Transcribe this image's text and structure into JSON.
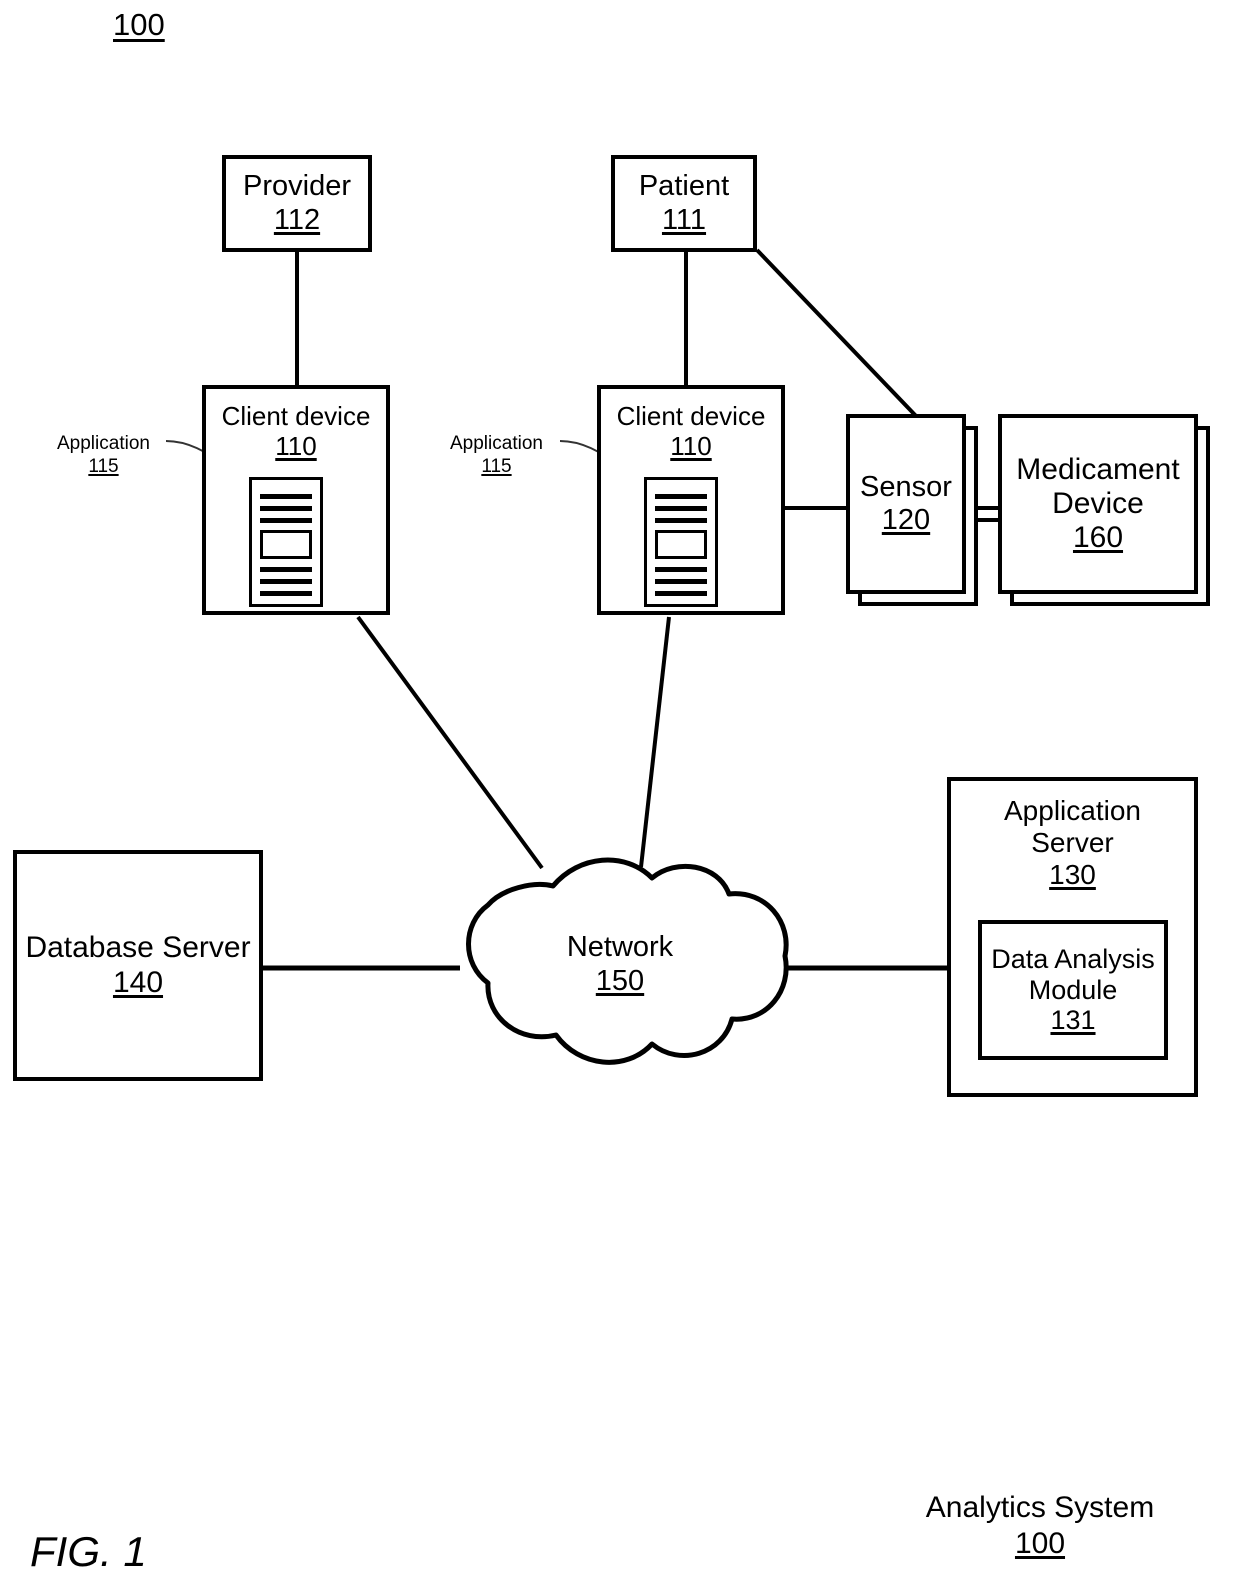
{
  "figure": {
    "top_reference": "100",
    "caption": "FIG. 1",
    "system_label": "Analytics System",
    "system_reference": "100"
  },
  "nodes": {
    "provider": {
      "title": "Provider",
      "ref": "112"
    },
    "patient": {
      "title": "Patient",
      "ref": "111"
    },
    "client_device_provider": {
      "title": "Client device",
      "ref": "110"
    },
    "client_device_patient": {
      "title": "Client device",
      "ref": "110"
    },
    "sensor": {
      "title": "Sensor",
      "ref": "120"
    },
    "medicament": {
      "title": "Medicament\nDevice",
      "ref": "160"
    },
    "network": {
      "title": "Network",
      "ref": "150"
    },
    "database_server": {
      "title": "Database Server",
      "ref": "140"
    },
    "application_server": {
      "title": "Application\nServer",
      "ref": "130"
    },
    "data_analysis_module": {
      "title": "Data Analysis\nModule",
      "ref": "131"
    }
  },
  "callouts": {
    "application_provider": {
      "title": "Application",
      "ref": "115"
    },
    "application_patient": {
      "title": "Application",
      "ref": "115"
    }
  },
  "icons": {
    "document_glyph": "document-icon",
    "cloud_glyph": "cloud-icon"
  },
  "style": {
    "stroke": "#000000",
    "fill": "#ffffff",
    "leader_stroke": "#333333"
  },
  "connections": [
    {
      "from": "provider",
      "to": "client_device_provider",
      "kind": "vertical"
    },
    {
      "from": "patient",
      "to": "client_device_patient",
      "kind": "vertical"
    },
    {
      "from": "patient",
      "to": "sensor",
      "kind": "diagonal"
    },
    {
      "from": "client_device_patient",
      "to": "sensor",
      "kind": "horizontal"
    },
    {
      "from": "sensor",
      "to": "medicament",
      "kind": "horizontal"
    },
    {
      "from": "client_device_provider",
      "to": "network",
      "kind": "diagonal"
    },
    {
      "from": "client_device_patient",
      "to": "network",
      "kind": "diagonal"
    },
    {
      "from": "database_server",
      "to": "network",
      "kind": "horizontal"
    },
    {
      "from": "network",
      "to": "application_server",
      "kind": "horizontal"
    }
  ]
}
